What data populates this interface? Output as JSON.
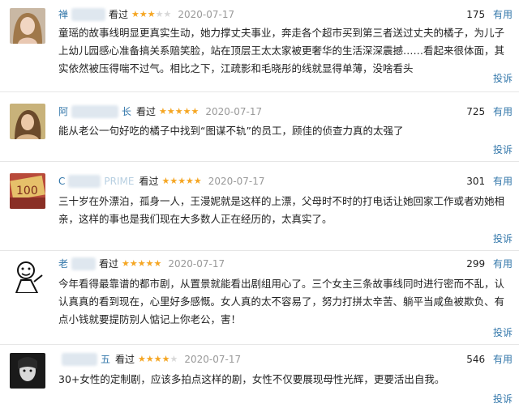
{
  "reviews": [
    {
      "user": "禅",
      "seen": "看过",
      "rating": 3,
      "date": "2020-07-17",
      "votes": "175",
      "useful_label": "有用",
      "content": "童瑶的故事线明显更真实生动，她力撑丈夫事业，奔走各个超市买到第三者送过丈夫的橘子，为儿子上幼儿园感心准备搞关系赔笑脸，站在顶层王太太家被更奢华的生活深深震撼……看起来很体面，其实依然被压得喘不过气。相比之下，江疏影和毛晓彤的线就显得单薄，没啥看头",
      "report_label": "投诉"
    },
    {
      "user": "阿",
      "user_suffix": "长",
      "seen": "看过",
      "rating": 5,
      "date": "2020-07-17",
      "votes": "725",
      "useful_label": "有用",
      "content": "能从老公一句好吃的橘子中找到“图谋不轨”的员工，顾佳的侦查力真的太强了",
      "report_label": "投诉"
    },
    {
      "user": "C",
      "user_suffix": "PRIME",
      "seen": "看过",
      "rating": 5,
      "date": "2020-07-17",
      "votes": "301",
      "useful_label": "有用",
      "content": "三十岁在外漂泊，孤身一人，王漫妮就是这样的上漂，父母时不时的打电话让她回家工作或者劝她相亲，这样的事也是我们现在大多数人正在经历的，太真实了。",
      "report_label": "投诉"
    },
    {
      "user": "老",
      "seen": "看过",
      "rating": 5,
      "date": "2020-07-17",
      "votes": "299",
      "useful_label": "有用",
      "content": "今年看得最靠谱的都市剧，从置景就能看出剧组用心了。三个女主三条故事线同时进行密而不乱，认认真真的看到现在，心里好多感慨。女人真的太不容易了，努力打拼太辛苦、躺平当咸鱼被欺负、有点小钱就要提防别人惦记上你老公，害！",
      "report_label": "投诉"
    },
    {
      "user": "",
      "user_suffix": "五",
      "seen": "看过",
      "rating": 4,
      "date": "2020-07-17",
      "votes": "546",
      "useful_label": "有用",
      "content": "30+女性的定制剧，应该多拍点这样的剧，女性不仅要展现母性光辉，更要活出自我。",
      "report_label": "投诉"
    }
  ]
}
